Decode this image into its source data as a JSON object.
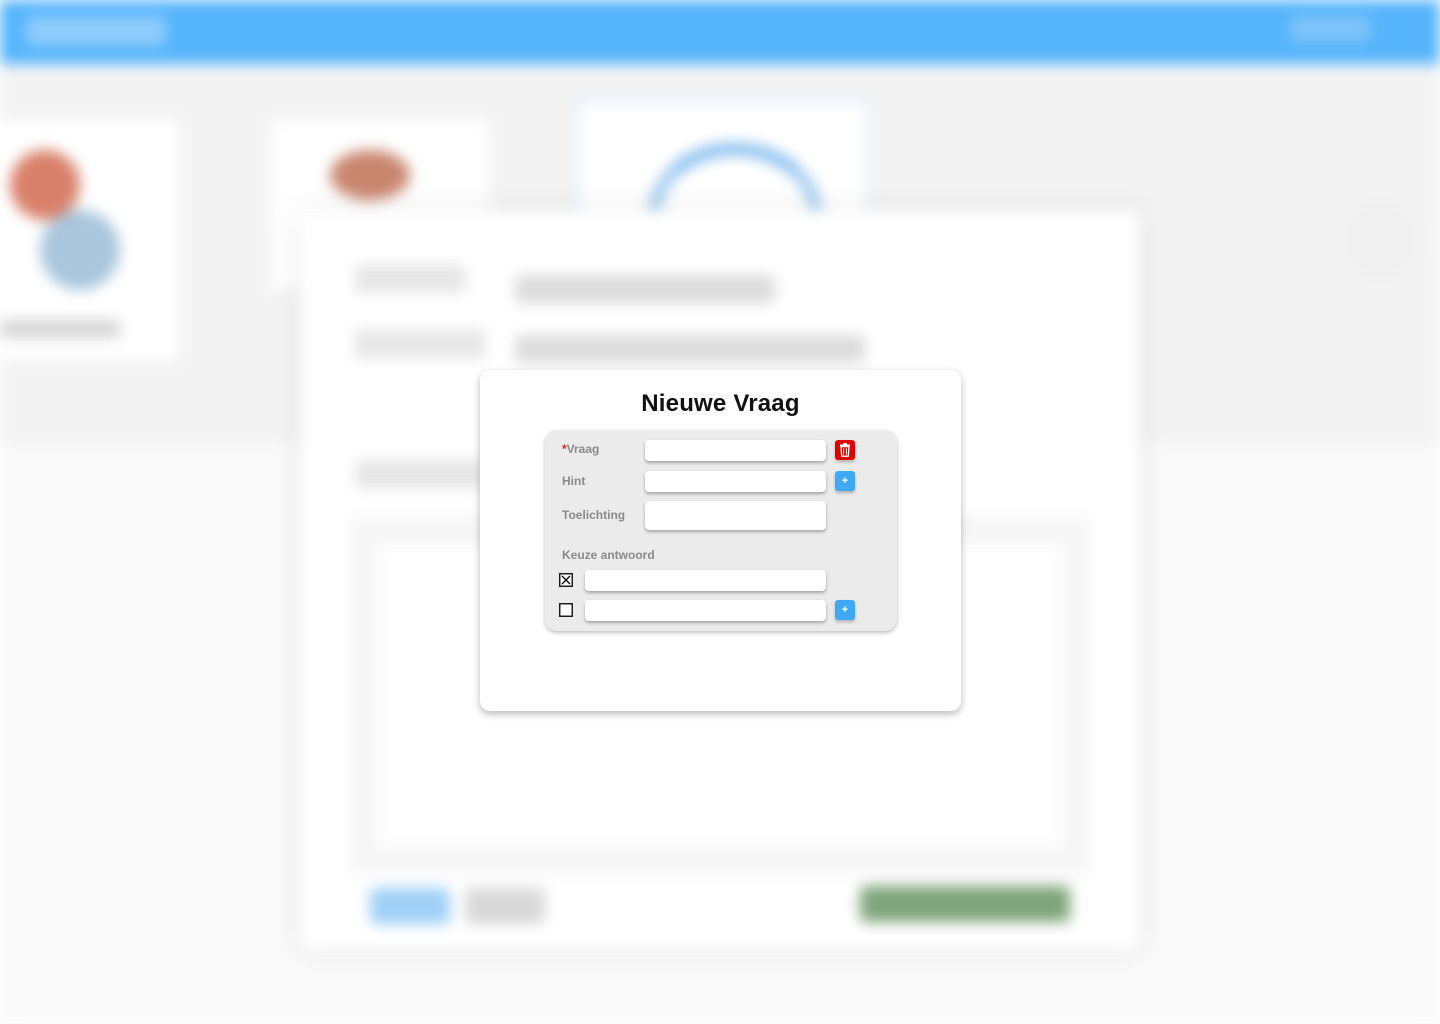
{
  "modal": {
    "title": "Nieuwe Vraag"
  },
  "form": {
    "question": {
      "required_mark": "*",
      "label": "Vraag",
      "value": "",
      "delete_icon": "trash-icon"
    },
    "hint": {
      "label": "Hint",
      "value": "",
      "add_label": "+"
    },
    "explanation": {
      "label": "Toelichting",
      "value": ""
    },
    "choices": {
      "label": "Keuze antwoord",
      "options": [
        {
          "checked": true,
          "value": "",
          "check_icon": "checkbox-checked-icon"
        },
        {
          "checked": false,
          "value": "",
          "check_icon": "checkbox-empty-icon",
          "add_label": "+"
        }
      ]
    }
  },
  "colors": {
    "primary_blue": "#3fa9f5",
    "danger_red": "#e00000",
    "topbar_blue": "#55b4fb"
  }
}
